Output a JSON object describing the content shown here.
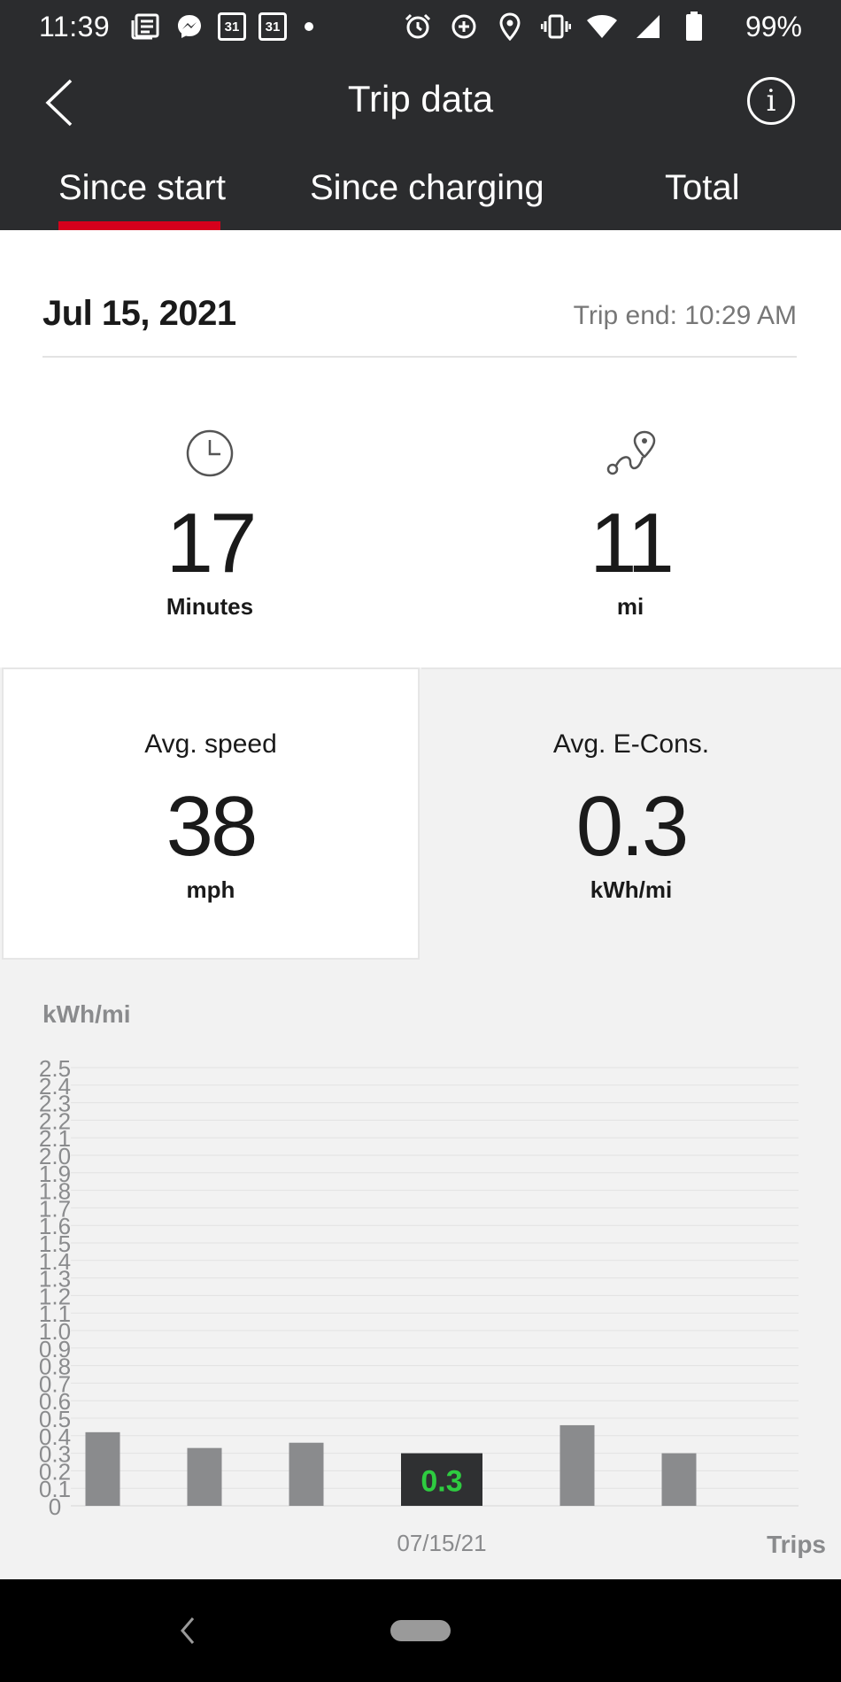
{
  "status_bar": {
    "time": "11:39",
    "battery": "99%",
    "calendar_day_1": "31",
    "calendar_day_2": "31",
    "icons_left": [
      "news-icon",
      "messenger-icon",
      "calendar-icon",
      "calendar-icon",
      "dot-icon"
    ],
    "icons_right": [
      "alarm-icon",
      "data-saver-icon",
      "location-icon",
      "vibrate-icon",
      "wifi-icon",
      "signal-icon",
      "battery-icon"
    ]
  },
  "header": {
    "title": "Trip data",
    "back_icon": "chevron-left-icon",
    "info_label": "i"
  },
  "tabs": [
    {
      "label": "Since start",
      "active": true
    },
    {
      "label": "Since charging",
      "active": false
    },
    {
      "label": "Total",
      "active": false
    }
  ],
  "accent_color": "#d5001c",
  "trip": {
    "date": "Jul 15, 2021",
    "end": "Trip end: 10:29 AM",
    "duration": {
      "value": "17",
      "unit": "Minutes",
      "icon": "clock-icon"
    },
    "distance": {
      "value": "11",
      "unit": "mi",
      "icon": "route-icon"
    }
  },
  "stats": {
    "avg_speed": {
      "label": "Avg. speed",
      "value": "38",
      "unit": "mph"
    },
    "avg_econs": {
      "label": "Avg. E-Cons.",
      "value": "0.3",
      "unit": "kWh/mi"
    }
  },
  "chart_data": {
    "type": "bar",
    "ylabel": "kWh/mi",
    "xlabel": "Trips",
    "ylim": [
      0,
      2.5
    ],
    "yticks": [
      "0",
      "0.1",
      "0.2",
      "0.3",
      "0.4",
      "0.5",
      "0.6",
      "0.7",
      "0.8",
      "0.9",
      "1.0",
      "1.1",
      "1.2",
      "1.3",
      "1.4",
      "1.5",
      "1.6",
      "1.7",
      "1.8",
      "1.9",
      "2.0",
      "2.1",
      "2.2",
      "2.3",
      "2.4",
      "2.5"
    ],
    "values": [
      0.42,
      0.33,
      0.36,
      0.3,
      0.46,
      0.3
    ],
    "selected_index": 3,
    "selected_label": "0.3",
    "selected_date": "07/15/21",
    "grid": true,
    "bar_color": "#8a8b8d",
    "selected_bar_color": "#2f3032",
    "selected_value_color": "#2ecc40"
  },
  "nav_bar": {
    "back_icon": "nav-back-icon",
    "home_icon": "nav-home-pill"
  }
}
